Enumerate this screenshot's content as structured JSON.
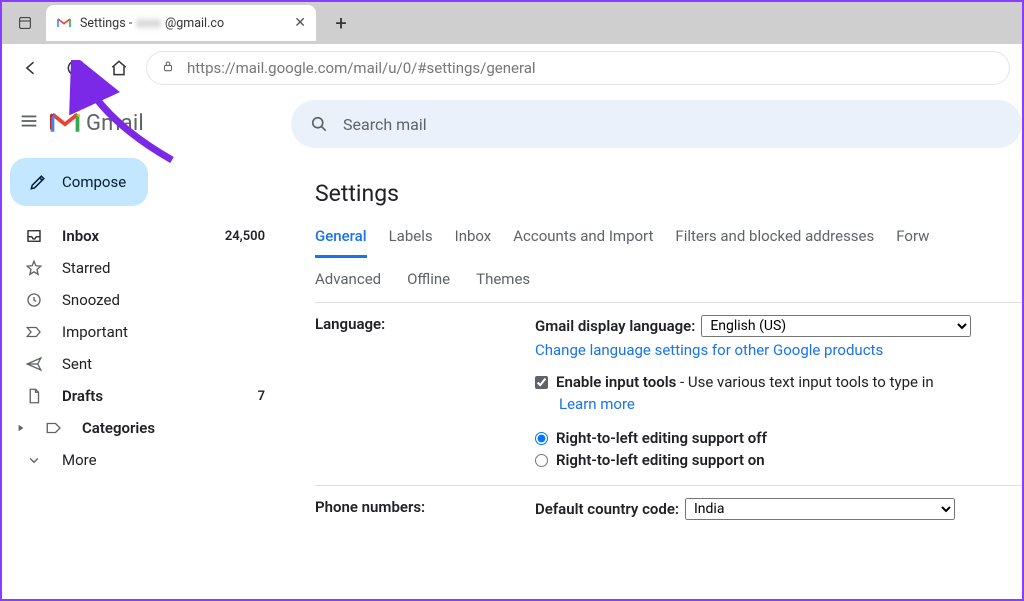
{
  "browser": {
    "tab_title_prefix": "Settings -",
    "tab_title_email_masked": "xxxx",
    "tab_title_suffix": "@gmail.co",
    "url": "https://mail.google.com/mail/u/0/#settings/general"
  },
  "app": {
    "brand": "Gmail",
    "compose_label": "Compose",
    "search_placeholder": "Search mail"
  },
  "sidebar": {
    "items": [
      {
        "icon": "inbox",
        "label": "Inbox",
        "count": "24,500",
        "active": true
      },
      {
        "icon": "star",
        "label": "Starred"
      },
      {
        "icon": "clock",
        "label": "Snoozed"
      },
      {
        "icon": "important",
        "label": "Important"
      },
      {
        "icon": "send",
        "label": "Sent"
      },
      {
        "icon": "draft",
        "label": "Drafts",
        "count": "7",
        "bold": true
      },
      {
        "icon": "category",
        "label": "Categories",
        "bold": true,
        "expandable": true
      },
      {
        "icon": "more",
        "label": "More"
      }
    ]
  },
  "settings": {
    "title": "Settings",
    "tabs": [
      "General",
      "Labels",
      "Inbox",
      "Accounts and Import",
      "Filters and blocked addresses",
      "Forwarding"
    ],
    "tabs2": [
      "Advanced",
      "Offline",
      "Themes"
    ],
    "active_tab": "General",
    "language": {
      "key_label": "Language:",
      "display_label": "Gmail display language:",
      "display_value": "English (US)",
      "change_link": "Change language settings for other Google products",
      "enable_tools_label": "Enable input tools",
      "enable_tools_desc": " - Use various text input tools to type in",
      "enable_tools_checked": true,
      "learn_more": "Learn more",
      "rtl_off": "Right-to-left editing support off",
      "rtl_on": "Right-to-left editing support on",
      "rtl_selected": "off"
    },
    "phone": {
      "key_label": "Phone numbers:",
      "country_label": "Default country code:",
      "country_value": "India"
    }
  }
}
